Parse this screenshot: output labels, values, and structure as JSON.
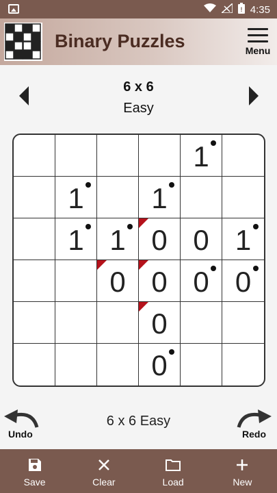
{
  "status_bar": {
    "time": "4:35",
    "icons": [
      "gallery-icon",
      "wifi-icon",
      "signal-icon",
      "battery-icon"
    ]
  },
  "app_bar": {
    "title": "Binary Puzzles",
    "menu_label": "Menu"
  },
  "selector": {
    "size": "6 x 6",
    "difficulty": "Easy"
  },
  "board": {
    "rows": 6,
    "cols": 6,
    "cells": [
      [
        {
          "v": "",
          "dot": false,
          "flag": false
        },
        {
          "v": "",
          "dot": false,
          "flag": false
        },
        {
          "v": "",
          "dot": false,
          "flag": false
        },
        {
          "v": "",
          "dot": false,
          "flag": false
        },
        {
          "v": "1",
          "dot": true,
          "flag": false
        },
        {
          "v": "",
          "dot": false,
          "flag": false
        }
      ],
      [
        {
          "v": "",
          "dot": false,
          "flag": false
        },
        {
          "v": "1",
          "dot": true,
          "flag": false
        },
        {
          "v": "",
          "dot": false,
          "flag": false
        },
        {
          "v": "1",
          "dot": true,
          "flag": false
        },
        {
          "v": "",
          "dot": false,
          "flag": false
        },
        {
          "v": "",
          "dot": false,
          "flag": false
        }
      ],
      [
        {
          "v": "",
          "dot": false,
          "flag": false
        },
        {
          "v": "1",
          "dot": true,
          "flag": false
        },
        {
          "v": "1",
          "dot": true,
          "flag": false
        },
        {
          "v": "0",
          "dot": false,
          "flag": true
        },
        {
          "v": "0",
          "dot": false,
          "flag": false
        },
        {
          "v": "1",
          "dot": true,
          "flag": false
        }
      ],
      [
        {
          "v": "",
          "dot": false,
          "flag": false
        },
        {
          "v": "",
          "dot": false,
          "flag": false
        },
        {
          "v": "0",
          "dot": false,
          "flag": true
        },
        {
          "v": "0",
          "dot": false,
          "flag": true
        },
        {
          "v": "0",
          "dot": true,
          "flag": false
        },
        {
          "v": "0",
          "dot": true,
          "flag": false
        }
      ],
      [
        {
          "v": "",
          "dot": false,
          "flag": false
        },
        {
          "v": "",
          "dot": false,
          "flag": false
        },
        {
          "v": "",
          "dot": false,
          "flag": false
        },
        {
          "v": "0",
          "dot": false,
          "flag": true
        },
        {
          "v": "",
          "dot": false,
          "flag": false
        },
        {
          "v": "",
          "dot": false,
          "flag": false
        }
      ],
      [
        {
          "v": "",
          "dot": false,
          "flag": false
        },
        {
          "v": "",
          "dot": false,
          "flag": false
        },
        {
          "v": "",
          "dot": false,
          "flag": false
        },
        {
          "v": "0",
          "dot": true,
          "flag": false
        },
        {
          "v": "",
          "dot": false,
          "flag": false
        },
        {
          "v": "",
          "dot": false,
          "flag": false
        }
      ]
    ],
    "flag_color": "#b5121b"
  },
  "controls": {
    "undo_label": "Undo",
    "redo_label": "Redo",
    "puzzle_name": "6 x 6 Easy"
  },
  "bottom_bar": {
    "items": [
      {
        "label": "Save",
        "icon": "save-icon"
      },
      {
        "label": "Clear",
        "icon": "close-icon"
      },
      {
        "label": "Load",
        "icon": "folder-icon"
      },
      {
        "label": "New",
        "icon": "plus-icon"
      }
    ]
  },
  "colors": {
    "bar": "#7a5a4f",
    "title": "#4b2c22"
  }
}
